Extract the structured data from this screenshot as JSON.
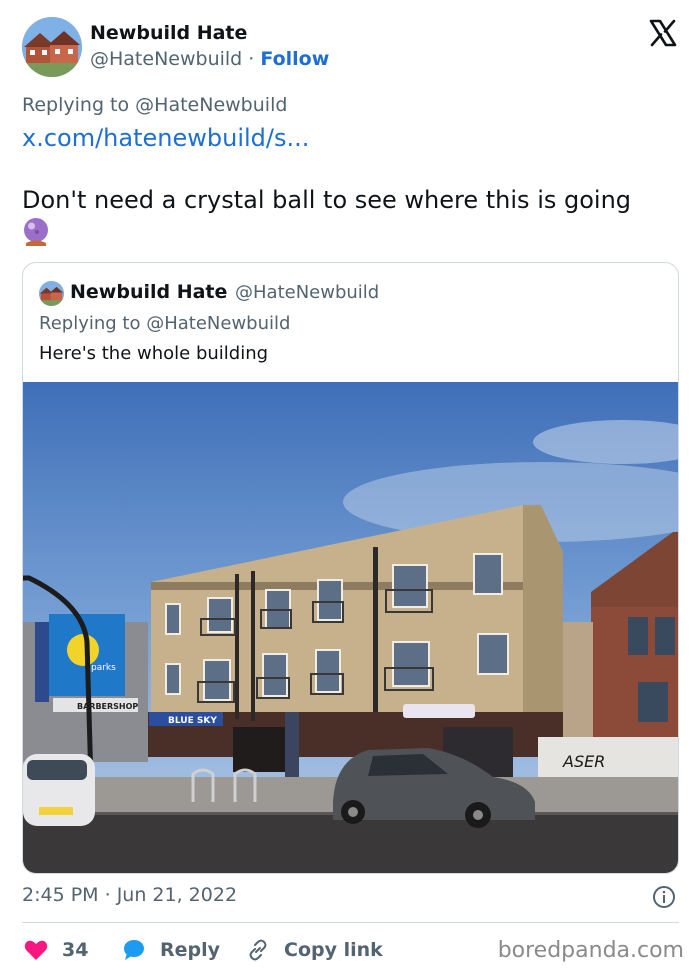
{
  "author": {
    "name": "Newbuild Hate",
    "handle": "@HateNewbuild",
    "separator": "·",
    "follow_label": "Follow",
    "avatar_icon": "house-avatar"
  },
  "platform_logo": "x-logo-icon",
  "tweet": {
    "replying_prefix": "Replying to",
    "replying_to": "@HateNewbuild",
    "link": "x.com/hatenewbuild/s...",
    "text": "Don't need a crystal ball to see where this is going",
    "emoji": "crystal-ball-icon"
  },
  "quoted": {
    "name": "Newbuild Hate",
    "handle": "@HateNewbuild",
    "replying_prefix": "Replying to",
    "replying_to": "@HateNewbuild",
    "text": "Here's the whole building",
    "photo_signs": {
      "left_sign": "parks",
      "barbershop": "BARBERSHOP",
      "shop_sign": "BLUE SKY",
      "graffiti": "ASER"
    }
  },
  "meta": {
    "time": "2:45 PM",
    "separator": "·",
    "date": "Jun 21, 2022"
  },
  "actions": {
    "like_count": "34",
    "reply_label": "Reply",
    "copy_label": "Copy link"
  },
  "watermark": "boredpanda.com",
  "colors": {
    "accent_blue": "#1d6fd6",
    "like_red": "#f91880",
    "muted_text": "#536471",
    "border": "#cfd9de"
  }
}
